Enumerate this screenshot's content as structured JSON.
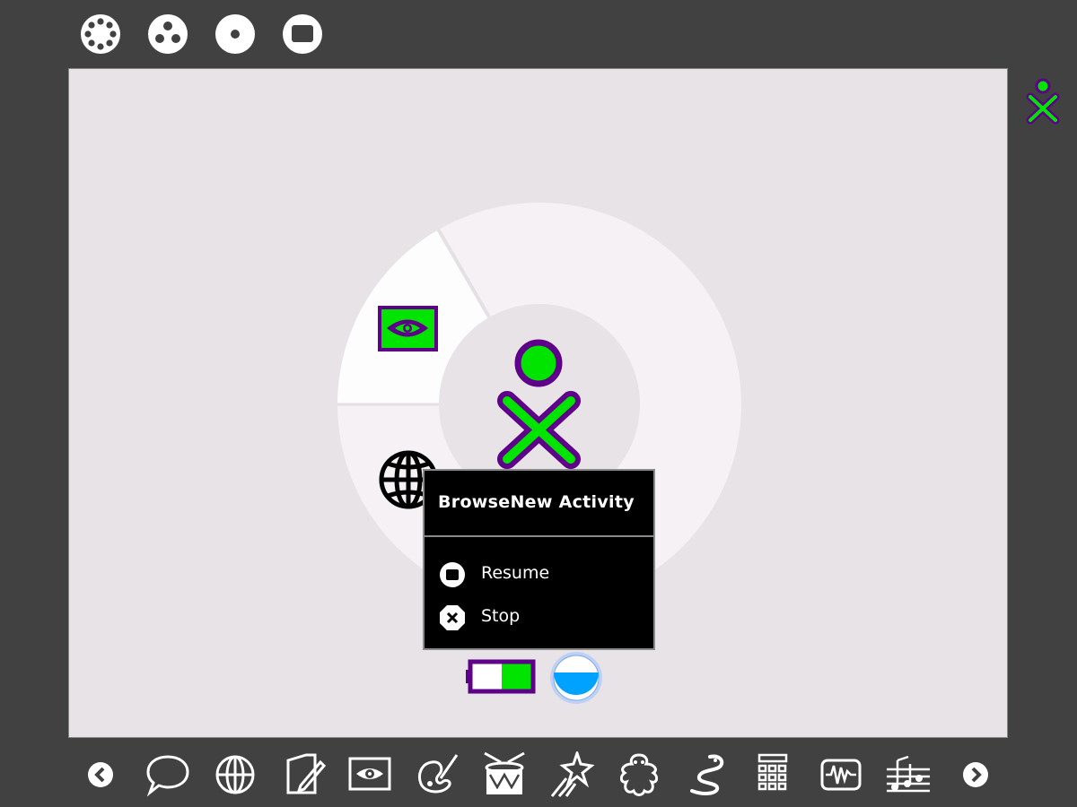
{
  "top_bar": {
    "views": [
      {
        "name": "neighborhood-view",
        "icon": "neighborhood-icon"
      },
      {
        "name": "group-view",
        "icon": "group-icon"
      },
      {
        "name": "home-view",
        "icon": "home-icon"
      },
      {
        "name": "activity-view",
        "icon": "activity-icon"
      }
    ]
  },
  "buddy": {
    "icon": "xo-buddy-icon",
    "stroke": "#5e008a",
    "fill": "#00e400"
  },
  "palette": {
    "title": "BrowseNew Activity",
    "items": [
      {
        "label": "Resume",
        "icon": "resume-icon"
      },
      {
        "label": "Stop",
        "icon": "stop-icon"
      }
    ]
  },
  "ring_activities": [
    {
      "name": "eye-activity",
      "icon": "view-source-icon"
    },
    {
      "name": "browse-activity",
      "icon": "browse-icon"
    }
  ],
  "devices": [
    {
      "name": "battery",
      "icon": "battery-icon",
      "level": 0.5
    },
    {
      "name": "journal-volume",
      "icon": "journal-volume-icon",
      "level": 0.5
    }
  ],
  "tray": {
    "items": [
      "scroll-left-icon",
      "chat-icon",
      "browse-icon",
      "write-icon",
      "imageviewer-icon",
      "paint-icon",
      "tamtam-icon",
      "turtleart-icon",
      "etoys-icon",
      "pippy-icon",
      "calculate-icon",
      "measure-icon",
      "tamtamedit-icon",
      "scroll-right-icon"
    ]
  },
  "colors": {
    "accent_green": "#00e400",
    "accent_purple": "#5e008a",
    "frame_gray": "#414141",
    "canvas": "#e7e3e7",
    "volume_blue": "#00a2ff"
  }
}
